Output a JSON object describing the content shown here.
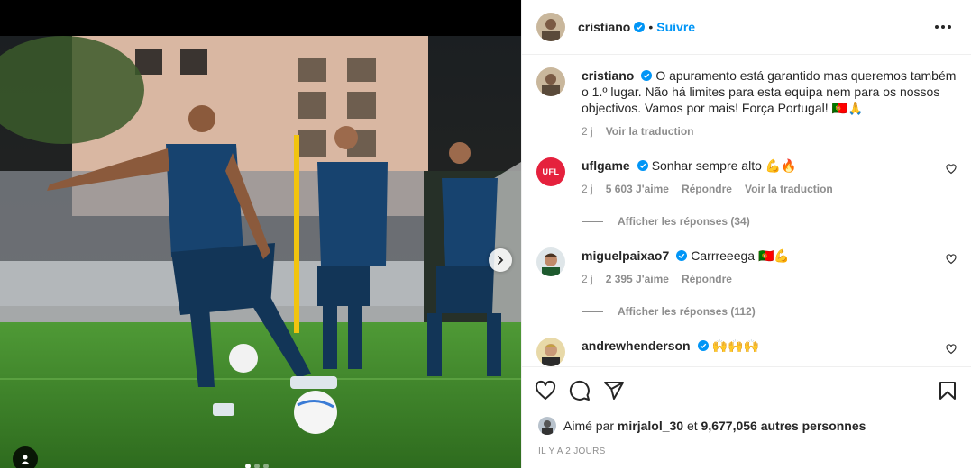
{
  "header": {
    "username": "cristiano",
    "separator": "•",
    "follow_label": "Suivre"
  },
  "caption": {
    "username": "cristiano",
    "text": "O apuramento está garantido mas queremos também o 1.º lugar. Não há limites para esta equipa nem para os nossos objectivos. Vamos por mais! Força Portugal! ",
    "emoji_tail": "🇵🇹🙏",
    "time": "2 j",
    "translate_label": "Voir la traduction"
  },
  "comments": [
    {
      "username": "uflgame",
      "avatar_text": "UFL",
      "text": "Sonhar sempre alto ",
      "emoji": "💪🔥",
      "time": "2 j",
      "likes": "5 603 J'aime",
      "reply_label": "Répondre",
      "translate_label": "Voir la traduction",
      "replies_label": "Afficher les réponses (34)"
    },
    {
      "username": "miguelpaixao7",
      "text": "Carrreeega ",
      "emoji": "🇵🇹💪",
      "time": "2 j",
      "likes": "2 395 J'aime",
      "reply_label": "Répondre",
      "replies_label": "Afficher les réponses (112)"
    },
    {
      "username": "andrewhenderson",
      "text": "",
      "emoji": "🙌🙌🙌"
    }
  ],
  "liked_by": {
    "prefix": "Aimé par ",
    "user": "mirjalol_30",
    "middle": " et ",
    "count": "9,677,056 autres personnes"
  },
  "timestamp": "IL Y A 2 JOURS",
  "colors": {
    "accent": "#0095f6",
    "verified": "#0095f6",
    "muted": "#8e8e8e",
    "text": "#262626"
  },
  "icons": [
    "heart-icon",
    "comment-icon",
    "share-icon",
    "bookmark-icon",
    "more-icon",
    "chevron-right-icon",
    "user-tag-icon",
    "verified-icon"
  ]
}
